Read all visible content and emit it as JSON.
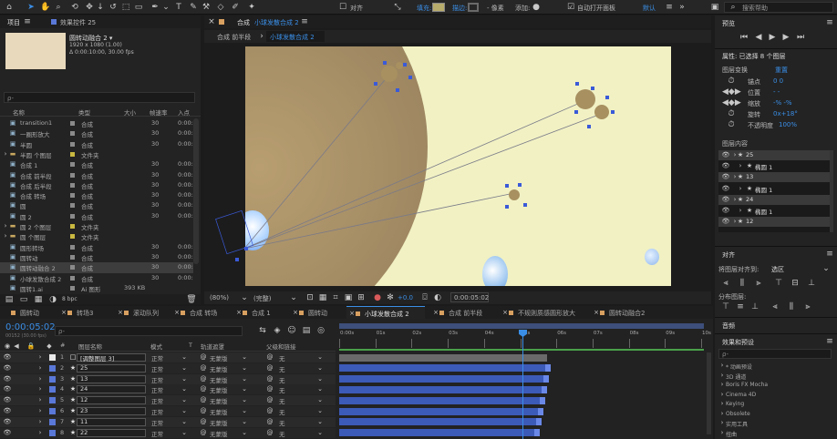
{
  "toolbar": {
    "align_label": "对齐",
    "fill_label": "填充:",
    "stroke_label": "描边:",
    "px_label": "- 像素",
    "add_label": "添加:",
    "auto_open_label": "自动打开面板",
    "workspace": "默认",
    "search_placeholder": "搜索帮助",
    "fill_color": "#b8ac6c",
    "stroke_color": "#6a6a6a"
  },
  "project": {
    "tab_label": "项目",
    "effects_tab": "效果控件 25",
    "comp_name": "圆转动融合 2 ▾",
    "comp_size": "1920 x 1080 (1.00)",
    "comp_time": "Δ 0:00:10:00, 30.00 fps",
    "thumb_color": "#e8d9bc",
    "search_placeholder": "ρ-",
    "columns": [
      "名称",
      "类型",
      "大小",
      "帧速率",
      "入点"
    ],
    "rows": [
      {
        "name": "transition1",
        "type": "合成",
        "fps": "30",
        "in": "0:00:"
      },
      {
        "name": "一圈形放大",
        "type": "合成",
        "fps": "30",
        "in": "0:00:"
      },
      {
        "name": "半圆",
        "type": "合成",
        "fps": "30",
        "in": "0:00:"
      },
      {
        "name": "半圆 个图层",
        "type": "文件夹",
        "fps": "",
        "in": ""
      },
      {
        "name": "合成 1",
        "type": "合成",
        "fps": "30",
        "in": "0:00:"
      },
      {
        "name": "合成 前半段",
        "type": "合成",
        "fps": "30",
        "in": "0:00:"
      },
      {
        "name": "合成 后半段",
        "type": "合成",
        "fps": "30",
        "in": "0:00:"
      },
      {
        "name": "合成 转场",
        "type": "合成",
        "fps": "30",
        "in": "0:00:"
      },
      {
        "name": "圆",
        "type": "合成",
        "fps": "30",
        "in": "0:00:"
      },
      {
        "name": "圆 2",
        "type": "合成",
        "fps": "30",
        "in": "0:00:"
      },
      {
        "name": "圆 2 个图层",
        "type": "文件夹",
        "fps": "",
        "in": ""
      },
      {
        "name": "圆 个图层",
        "type": "文件夹",
        "fps": "",
        "in": ""
      },
      {
        "name": "圆形转场",
        "type": "合成",
        "fps": "30",
        "in": "0:00:"
      },
      {
        "name": "圆转动",
        "type": "合成",
        "fps": "30",
        "in": "0:00:"
      },
      {
        "name": "圆转动融合 2",
        "type": "合成",
        "fps": "30",
        "in": "0:00:"
      },
      {
        "name": "小球发散合成 2",
        "type": "合成",
        "fps": "30",
        "in": "0:00:"
      },
      {
        "name": "圆转1.ai",
        "type": "Ai 图形",
        "size": "393 KB",
        "fps": "",
        "in": ""
      }
    ],
    "bpc": "8 bpc"
  },
  "comp_viewer": {
    "tab_prefix": "合成",
    "tab_name": "小球发散合成 2",
    "crumb_1": "合成 前半段",
    "crumb_2": "小球发散合成 2",
    "zoom": "(80%)",
    "quality": "(完整)",
    "exposure": "+0.0",
    "timecode": "0:00:05:02",
    "bg_color": "#f1f1c4",
    "big_circle_color": "#a98f67"
  },
  "right": {
    "preview_title": "预览",
    "properties_title": "属性: 已选择 8 个图层",
    "layer_transform": "图层变换",
    "reset": "重置",
    "anchor": "锚点",
    "anchor_val": "0   0",
    "position": "位置",
    "position_val": "-   -",
    "scale": "缩放",
    "scale_val": "-%   -%",
    "rotation": "旋转",
    "rotation_val": "0x+18°",
    "opacity": "不透明度",
    "opacity_val": "100%",
    "layer_content": "图层内容",
    "content_items": [
      "25",
      "椭圆 1",
      "13",
      "椭圆 1",
      "24",
      "椭圆 1",
      "12"
    ],
    "align_title": "对齐",
    "align_to_label": "将图层对齐到:",
    "align_to_value": "选区",
    "distribute_label": "分布图层:",
    "audio_title": "音频",
    "effects_title": "效果和预设",
    "effects_search": "ρ-",
    "effects_items": [
      "* 动画预设",
      "3D 通道",
      "Boris FX Mocha",
      "Cinema 4D",
      "Keying",
      "Obsolete",
      "实用工具",
      "扭曲"
    ]
  },
  "timeline": {
    "tabs": [
      "圆转动",
      "转场3",
      "滚动队列",
      "合成 转场",
      "合成 1",
      "圆转动",
      "小球发散合成 2",
      "合成 前半段",
      "不规则质感圆形放大",
      "圆转动融合2"
    ],
    "timecode": "0:00:05:02",
    "timecode_sub": "00152 (30.00 fps)",
    "search_placeholder": "ρ-",
    "columns": {
      "num": "#",
      "name": "图层名称",
      "mode": "模式",
      "t": "T",
      "matte": "轨道遮罩",
      "parent": "父级和链接"
    },
    "ruler": [
      "0:00s",
      "01s",
      "02s",
      "03s",
      "04s",
      "05s",
      "06s",
      "07s",
      "08s",
      "09s",
      "10s"
    ],
    "layers": [
      {
        "num": "1",
        "name": "[调整图层 3]",
        "mode": "正常",
        "matte": "无蒙版",
        "parent": "无",
        "color": "#e8e8e8"
      },
      {
        "num": "2",
        "name": "25",
        "mode": "正常",
        "matte": "无蒙版",
        "parent": "无",
        "color": "#5a78d8"
      },
      {
        "num": "3",
        "name": "13",
        "mode": "正常",
        "matte": "无蒙版",
        "parent": "无",
        "color": "#5a78d8"
      },
      {
        "num": "4",
        "name": "24",
        "mode": "正常",
        "matte": "无蒙版",
        "parent": "无",
        "color": "#5a78d8"
      },
      {
        "num": "5",
        "name": "12",
        "mode": "正常",
        "matte": "无蒙版",
        "parent": "无",
        "color": "#5a78d8"
      },
      {
        "num": "6",
        "name": "23",
        "mode": "正常",
        "matte": "无蒙版",
        "parent": "无",
        "color": "#5a78d8"
      },
      {
        "num": "7",
        "name": "11",
        "mode": "正常",
        "matte": "无蒙版",
        "parent": "无",
        "color": "#5a78d8"
      },
      {
        "num": "8",
        "name": "22",
        "mode": "正常",
        "matte": "无蒙版",
        "parent": "无",
        "color": "#5a78d8"
      }
    ]
  }
}
